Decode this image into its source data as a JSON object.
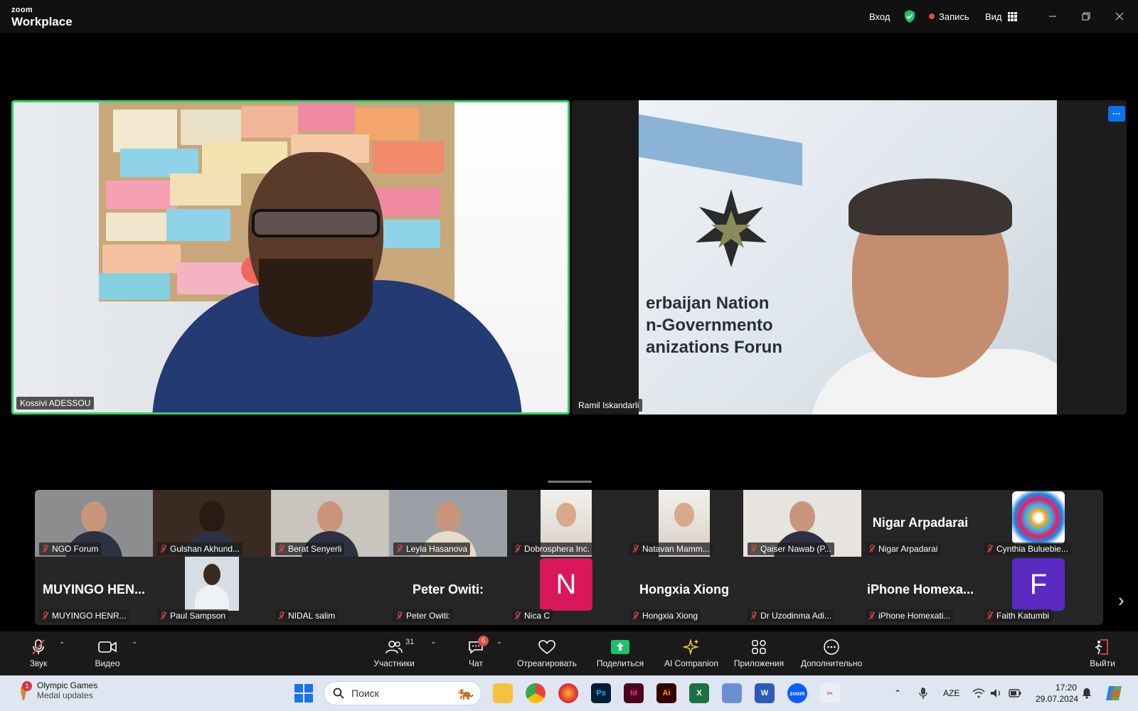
{
  "app": {
    "logo_top": "zoom",
    "logo_bottom": "Workplace"
  },
  "titlebar": {
    "login": "Вход",
    "record": "Запись",
    "view": "Вид"
  },
  "speakers": [
    {
      "name": "Kossivi ADESSOU",
      "active": true
    },
    {
      "name": "Ramil Iskandarli",
      "active": false
    }
  ],
  "slide_text": [
    "erbaijan Nation",
    "n-Governmento",
    "anizations Forun"
  ],
  "gallery": {
    "row1": [
      {
        "name": "NGO Forum",
        "type": "video"
      },
      {
        "name": "Gulshan Akhund...",
        "type": "video"
      },
      {
        "name": "Berat Senyerli",
        "type": "video"
      },
      {
        "name": "Leyla Hasanova",
        "type": "video"
      },
      {
        "name": "Dobrosphera Inc.",
        "type": "video"
      },
      {
        "name": "Natavan Mamm...",
        "type": "video"
      },
      {
        "name": "Qaiser Nawab (P...",
        "type": "video"
      },
      {
        "name": "Nigar Arpadarai",
        "type": "text",
        "display": "Nigar Arpadarai"
      },
      {
        "name": "Cynthia Buluebie...",
        "type": "logo"
      }
    ],
    "row2": [
      {
        "name": "MUYINGO HENR...",
        "type": "text",
        "display": "MUYINGO HEN..."
      },
      {
        "name": "Paul Sampson",
        "type": "video"
      },
      {
        "name": "NIDAL salim",
        "type": "blank"
      },
      {
        "name": "Peter Owiti:",
        "type": "text",
        "display": "Peter Owiti:"
      },
      {
        "name": "Nica C",
        "type": "avatar",
        "letter": "N",
        "color": "#d8185a"
      },
      {
        "name": "Hongxia Xiong",
        "type": "text",
        "display": "Hongxia Xiong"
      },
      {
        "name": "Dr Uzodinma Adi...",
        "type": "blank"
      },
      {
        "name": "iPhone Homexati...",
        "type": "text",
        "display": "iPhone  Homexa..."
      },
      {
        "name": "Faith Katumbi",
        "type": "avatar",
        "letter": "F",
        "color": "#5b2ac1"
      }
    ]
  },
  "toolbar": {
    "audio": "Звук",
    "video": "Видео",
    "participants": "Участники",
    "participants_count": "31",
    "chat": "Чат",
    "chat_badge": "6",
    "react": "Отреагировать",
    "share": "Поделиться",
    "ai": "AI Companion",
    "apps": "Приложения",
    "more": "Дополнительно",
    "leave": "Выйти"
  },
  "taskbar": {
    "notif_count": "1",
    "weather_title": "Olympic Games",
    "weather_sub": "Medal updates",
    "search_placeholder": "Поиск",
    "lang": "AZE",
    "time": "17:20",
    "date": "29.07.2024"
  },
  "colors": {
    "active_speaker": "#2fd26b",
    "zoom_blue": "#0e72ed",
    "record_red": "#e5484d"
  }
}
